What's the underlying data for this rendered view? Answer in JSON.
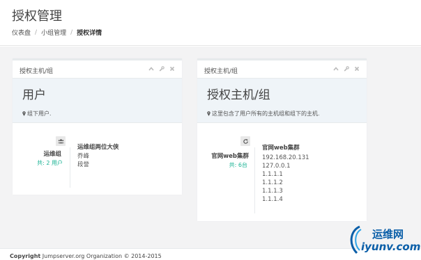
{
  "header": {
    "title": "授权管理",
    "breadcrumb": [
      "仪表盘",
      "小组管理",
      "授权详情"
    ]
  },
  "left_panel": {
    "title": "授权主机/组",
    "hero_name": "用户",
    "hero_desc": "组下用户.",
    "group_name": "运维组",
    "group_count": "共: 2 用户",
    "list_title": "运维组两位大侠",
    "items": [
      "乔峰",
      "段誉"
    ]
  },
  "right_panel": {
    "title": "授权主机/组",
    "hero_name": "授权主机/组",
    "hero_desc": "这里包含了用户所有的主机组和组下的主机.",
    "group_name": "官网web集群",
    "group_count": "共: 6台",
    "list_title": "官网web集群",
    "items": [
      "192.168.20.131",
      "127.0.0.1",
      "1.1.1.1",
      "1.1.1.2",
      "1.1.1.3",
      "1.1.1.4"
    ]
  },
  "footer": {
    "copyright_label": "Copyright",
    "copyright_text": "Jumpserver.org Organization © 2014-2015"
  },
  "watermark": {
    "brand": "运维网",
    "url": "iyunv.com"
  },
  "icons": {
    "collapse": "chevron-up-icon",
    "config": "wrench-icon",
    "close": "close-icon",
    "users": "users-icon",
    "refresh": "refresh-icon",
    "location": "map-marker-icon"
  },
  "colors": {
    "accent": "#1ab394",
    "hero_bg": "#eff4f8",
    "content_bg": "#f3f3f4"
  }
}
